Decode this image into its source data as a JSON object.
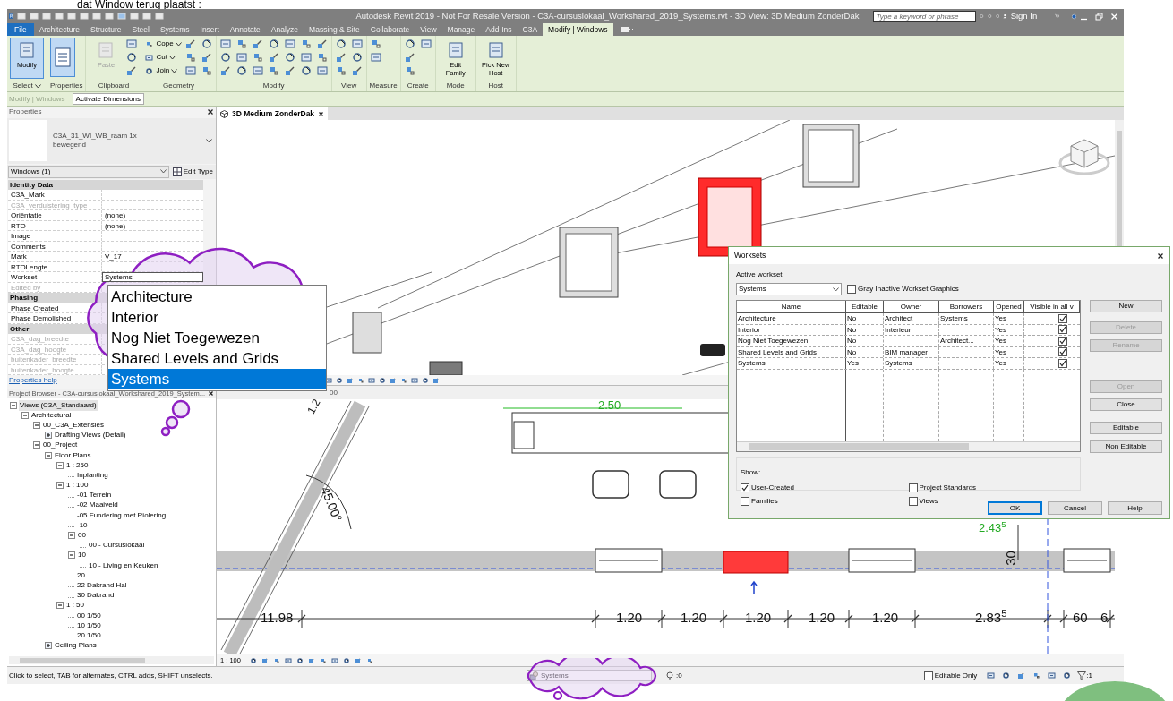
{
  "caption": "dat Window terug plaatst :",
  "title_bar": {
    "title": "Autodesk Revit 2019 - Not For Resale Version - C3A-cursuslokaal_Workshared_2019_Systems.rvt - 3D View: 3D Medium ZonderDak",
    "search_placeholder": "Type a keyword or phrase",
    "sign_in": "Sign In"
  },
  "ribbon_tabs": [
    {
      "label": "File",
      "kind": "file",
      "selected": false
    },
    {
      "label": "Architecture",
      "kind": "tab",
      "selected": false
    },
    {
      "label": "Structure",
      "kind": "tab",
      "selected": false
    },
    {
      "label": "Steel",
      "kind": "tab",
      "selected": false
    },
    {
      "label": "Systems",
      "kind": "tab",
      "selected": false
    },
    {
      "label": "Insert",
      "kind": "tab",
      "selected": false
    },
    {
      "label": "Annotate",
      "kind": "tab",
      "selected": false
    },
    {
      "label": "Analyze",
      "kind": "tab",
      "selected": false
    },
    {
      "label": "Massing & Site",
      "kind": "tab",
      "selected": false
    },
    {
      "label": "Collaborate",
      "kind": "tab",
      "selected": false
    },
    {
      "label": "View",
      "kind": "tab",
      "selected": false
    },
    {
      "label": "Manage",
      "kind": "tab",
      "selected": false
    },
    {
      "label": "Add-Ins",
      "kind": "tab",
      "selected": false
    },
    {
      "label": "C3A",
      "kind": "tab",
      "selected": false
    },
    {
      "label": "Modify | Windows",
      "kind": "tab",
      "selected": true
    }
  ],
  "ribbon_panels": [
    {
      "title": "Select",
      "tools": [
        {
          "kind": "large",
          "label": "Modify",
          "selected": true
        }
      ]
    },
    {
      "title": "Properties",
      "tools": [
        {
          "kind": "large_icon",
          "selected": true
        }
      ]
    },
    {
      "title": "Clipboard",
      "tools": [
        {
          "kind": "large",
          "label": "Paste",
          "selected": false,
          "disabled": true
        },
        {
          "kind": "icon"
        },
        {
          "kind": "icon"
        },
        {
          "kind": "icon"
        }
      ]
    },
    {
      "title": "Geometry",
      "tools": [
        {
          "kind": "small",
          "label": "Cope"
        },
        {
          "kind": "small",
          "label": "Cut"
        },
        {
          "kind": "small",
          "label": "Join"
        },
        {
          "kind": "icon"
        },
        {
          "kind": "icon"
        },
        {
          "kind": "icon"
        },
        {
          "kind": "icon"
        },
        {
          "kind": "icon"
        },
        {
          "kind": "icon"
        }
      ]
    },
    {
      "title": "Modify",
      "tools": [
        {
          "kind": "icon"
        },
        {
          "kind": "icon"
        },
        {
          "kind": "icon"
        },
        {
          "kind": "icon"
        },
        {
          "kind": "icon"
        },
        {
          "kind": "icon"
        },
        {
          "kind": "icon"
        },
        {
          "kind": "icon"
        },
        {
          "kind": "icon"
        },
        {
          "kind": "icon"
        },
        {
          "kind": "icon"
        },
        {
          "kind": "icon"
        },
        {
          "kind": "icon"
        },
        {
          "kind": "icon"
        },
        {
          "kind": "icon"
        },
        {
          "kind": "icon"
        },
        {
          "kind": "icon"
        },
        {
          "kind": "icon"
        },
        {
          "kind": "icon"
        },
        {
          "kind": "icon"
        },
        {
          "kind": "icon"
        }
      ]
    },
    {
      "title": "View",
      "tools": [
        {
          "kind": "icon"
        },
        {
          "kind": "icon"
        },
        {
          "kind": "icon"
        },
        {
          "kind": "icon"
        },
        {
          "kind": "icon"
        },
        {
          "kind": "icon"
        }
      ]
    },
    {
      "title": "Measure",
      "tools": [
        {
          "kind": "icon"
        },
        {
          "kind": "icon"
        }
      ]
    },
    {
      "title": "Create",
      "tools": [
        {
          "kind": "icon"
        },
        {
          "kind": "icon"
        },
        {
          "kind": "icon"
        },
        {
          "kind": "icon"
        }
      ]
    },
    {
      "title": "Mode",
      "tools": [
        {
          "kind": "large",
          "label": "Edit Family",
          "selected": false
        }
      ]
    },
    {
      "title": "Host",
      "tools": [
        {
          "kind": "large",
          "label": "Pick New Host",
          "selected": false
        }
      ]
    }
  ],
  "options_bar": {
    "context": "Modify | Windows",
    "button": "Activate Dimensions"
  },
  "properties": {
    "title": "Properties",
    "type_name": [
      "C3A_31_WI_WB_raam 1x",
      "bewegend"
    ],
    "selector": "Windows (1)",
    "edit_type": "Edit Type",
    "groups": [
      {
        "name": "Identity Data",
        "rows": [
          {
            "name": "C3A_Mark",
            "disabled": false,
            "active": false
          },
          {
            "name": "C3A_verduistering_type",
            "disabled": true,
            "active": false
          },
          {
            "name": "Oriëntatie",
            "value": "(none)",
            "disabled": false,
            "active": false
          },
          {
            "name": "RTO",
            "value": "(none)",
            "disabled": false,
            "active": false
          },
          {
            "name": "Image",
            "disabled": false,
            "active": false
          },
          {
            "name": "Comments",
            "disabled": false,
            "active": false
          },
          {
            "name": "Mark",
            "value": "V_17",
            "disabled": false,
            "active": false
          },
          {
            "name": "RTOLengte",
            "disabled": false,
            "active": false
          },
          {
            "name": "Workset",
            "value": "Systems",
            "disabled": false,
            "active": true
          },
          {
            "name": "Edited by",
            "disabled": true,
            "active": false
          }
        ]
      },
      {
        "name": "Phasing",
        "rows": [
          {
            "name": "Phase Created",
            "disabled": false,
            "active": false
          },
          {
            "name": "Phase Demolished",
            "disabled": false,
            "active": false
          }
        ]
      },
      {
        "name": "Other",
        "rows": [
          {
            "name": "C3A_dag_breedte",
            "disabled": true,
            "active": false
          },
          {
            "name": "C3A_dag_hoogte",
            "disabled": true,
            "active": false
          },
          {
            "name": "buitenkader_breedte",
            "disabled": true,
            "active": false
          },
          {
            "name": "buitenkader_hoogte",
            "disabled": true,
            "active": false
          }
        ]
      }
    ],
    "help_link": "Properties help"
  },
  "workset_dropdown": {
    "options": [
      {
        "label": "Architecture",
        "selected": false
      },
      {
        "label": "Interior",
        "selected": false
      },
      {
        "label": "Nog Niet Toegewezen",
        "selected": false
      },
      {
        "label": "Shared Levels and Grids",
        "selected": false
      },
      {
        "label": "Systems",
        "selected": true
      }
    ]
  },
  "project_browser": {
    "title": "Project Browser - C3A-cursuslokaal_Workshared_2019_System...",
    "tree": [
      {
        "label": "Views (C3A_Standaard)",
        "selected": true,
        "expanded": true,
        "children": [
          {
            "label": "Architectural",
            "selected": false,
            "expanded": true,
            "children": [
              {
                "label": "00_C3A_Extensies",
                "selected": false,
                "expanded": true,
                "children": [
                  {
                    "label": "Drafting Views (Detail)",
                    "selected": false,
                    "expanded": false
                  }
                ]
              },
              {
                "label": "00_Project",
                "selected": false,
                "expanded": true,
                "children": [
                  {
                    "label": "Floor Plans",
                    "selected": false,
                    "expanded": true,
                    "children": [
                      {
                        "label": "1 : 250",
                        "selected": false,
                        "expanded": true,
                        "children": [
                          {
                            "label": "Inplanting",
                            "selected": false
                          }
                        ]
                      },
                      {
                        "label": "1 : 100",
                        "selected": false,
                        "expanded": true,
                        "children": [
                          {
                            "label": "-01 Terrein",
                            "selected": false
                          },
                          {
                            "label": "-02 Maaiveld",
                            "selected": false
                          },
                          {
                            "label": "-05 Fundering met Riolering",
                            "selected": false
                          },
                          {
                            "label": "-10",
                            "selected": false
                          },
                          {
                            "label": "00",
                            "selected": false,
                            "expanded": true,
                            "children": [
                              {
                                "label": "00 - Cursuslokaal",
                                "selected": false
                              }
                            ]
                          },
                          {
                            "label": "10",
                            "selected": false,
                            "expanded": true,
                            "children": [
                              {
                                "label": "10 - Living en Keuken",
                                "selected": false
                              }
                            ]
                          },
                          {
                            "label": "20",
                            "selected": false
                          },
                          {
                            "label": "22 Dakrand Hal",
                            "selected": false
                          },
                          {
                            "label": "30 Dakrand",
                            "selected": false
                          }
                        ]
                      },
                      {
                        "label": "1 : 50",
                        "selected": false,
                        "expanded": true,
                        "children": [
                          {
                            "label": "00 1/50",
                            "selected": false
                          },
                          {
                            "label": "10 1/50",
                            "selected": false
                          },
                          {
                            "label": "20 1/50",
                            "selected": false
                          }
                        ]
                      }
                    ]
                  },
                  {
                    "label": "Ceiling Plans",
                    "selected": false,
                    "expanded": false
                  }
                ]
              }
            ]
          }
        ]
      }
    ]
  },
  "views": {
    "top_tab": "3D Medium ZonderDak",
    "bottom_tab": "00",
    "plan_scale": "1 : 100",
    "plan_labels": [
      "2.50",
      "1.2",
      "45.00°",
      "11.98",
      "1.20",
      "1.20",
      "1.20",
      "1.20",
      "1.20",
      "2.83$^{5}$",
      "60",
      "6",
      "2.43$^{5}$",
      "30"
    ]
  },
  "worksets_dialog": {
    "title": "Worksets",
    "active_label": "Active workset:",
    "active_value": "Systems",
    "gray_inactive": {
      "label": "Gray Inactive Workset Graphics",
      "checked": false
    },
    "columns": [
      "Name",
      "Editable",
      "Owner",
      "Borrowers",
      "Opened",
      "Visible in all v"
    ],
    "rows": [
      {
        "name": "Architecture",
        "editable": "No",
        "owner": "Architect",
        "borrowers": "Systems",
        "opened": "Yes",
        "visible": true
      },
      {
        "name": "Interior",
        "editable": "No",
        "owner": "Interieur",
        "opened": "Yes",
        "visible": true
      },
      {
        "name": "Nog Niet Toegewezen",
        "editable": "No",
        "borrowers": "Architect...",
        "opened": "Yes",
        "visible": true
      },
      {
        "name": "Shared Levels and Grids",
        "editable": "No",
        "owner": "BIM manager",
        "opened": "Yes",
        "visible": true
      },
      {
        "name": "Systems",
        "editable": "Yes",
        "owner": "Systems",
        "opened": "Yes",
        "visible": true
      }
    ],
    "side_buttons": [
      {
        "label": "New",
        "disabled": false
      },
      {
        "label": "Delete",
        "disabled": true
      },
      {
        "label": "Rename",
        "disabled": true
      },
      {
        "label": "Open",
        "disabled": true
      },
      {
        "label": "Close",
        "disabled": false
      },
      {
        "label": "Editable",
        "disabled": false
      },
      {
        "label": "Non Editable",
        "disabled": false
      }
    ],
    "show_label": "Show:",
    "show_options": [
      {
        "label": "User-Created",
        "checked": true
      },
      {
        "label": "Project Standards",
        "checked": false
      },
      {
        "label": "Families",
        "checked": false
      },
      {
        "label": "Views",
        "checked": false
      }
    ],
    "footer_buttons": [
      {
        "label": "OK",
        "default": true
      },
      {
        "label": "Cancel",
        "default": false
      },
      {
        "label": "Help",
        "default": false
      }
    ]
  },
  "status_bar": {
    "hint": "Click to select, TAB for alternates, CTRL adds, SHIFT unselects.",
    "workset": "Systems",
    "count_left": ":0",
    "editable_only": {
      "label": "Editable Only",
      "checked": false
    },
    "count_right": ":1"
  }
}
